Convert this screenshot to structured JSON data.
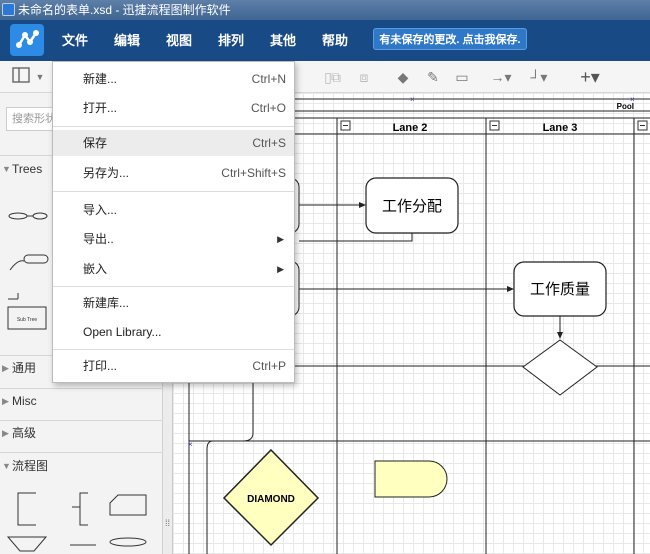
{
  "window": {
    "title": "未命名的表单.xsd - 迅捷流程图制作软件"
  },
  "menubar": {
    "items": [
      "文件",
      "编辑",
      "视图",
      "排列",
      "其他",
      "帮助"
    ],
    "save_notice": "有未保存的更改. 点击我保存."
  },
  "sidebar": {
    "search_placeholder": "搜索形状",
    "sections": [
      "Trees",
      "通用",
      "Misc",
      "高级",
      "流程图"
    ],
    "tree_shape_label": "Sub Tree"
  },
  "file_menu": {
    "items": [
      {
        "label": "新建...",
        "shortcut": "Ctrl+N"
      },
      {
        "label": "打开...",
        "shortcut": "Ctrl+O"
      },
      {
        "label": "保存",
        "shortcut": "Ctrl+S"
      },
      {
        "label": "另存为...",
        "shortcut": "Ctrl+Shift+S"
      },
      {
        "label": "导入...",
        "shortcut": ""
      },
      {
        "label": "导出..",
        "shortcut": ""
      },
      {
        "label": "嵌入",
        "shortcut": ""
      },
      {
        "label": "新建库...",
        "shortcut": ""
      },
      {
        "label": "Open Library...",
        "shortcut": ""
      },
      {
        "label": "打印...",
        "shortcut": "Ctrl+P"
      }
    ]
  },
  "diagram": {
    "pool_label": "Pool",
    "lanes": [
      "Lane 2",
      "Lane 3"
    ],
    "nodes": {
      "assign": "工作分配",
      "quality": "工作质量",
      "diamond": "DIAMOND"
    },
    "colors": {
      "note_fill": "#ffffc0",
      "menubar": "#184a86",
      "accent": "#2d8be6"
    }
  }
}
